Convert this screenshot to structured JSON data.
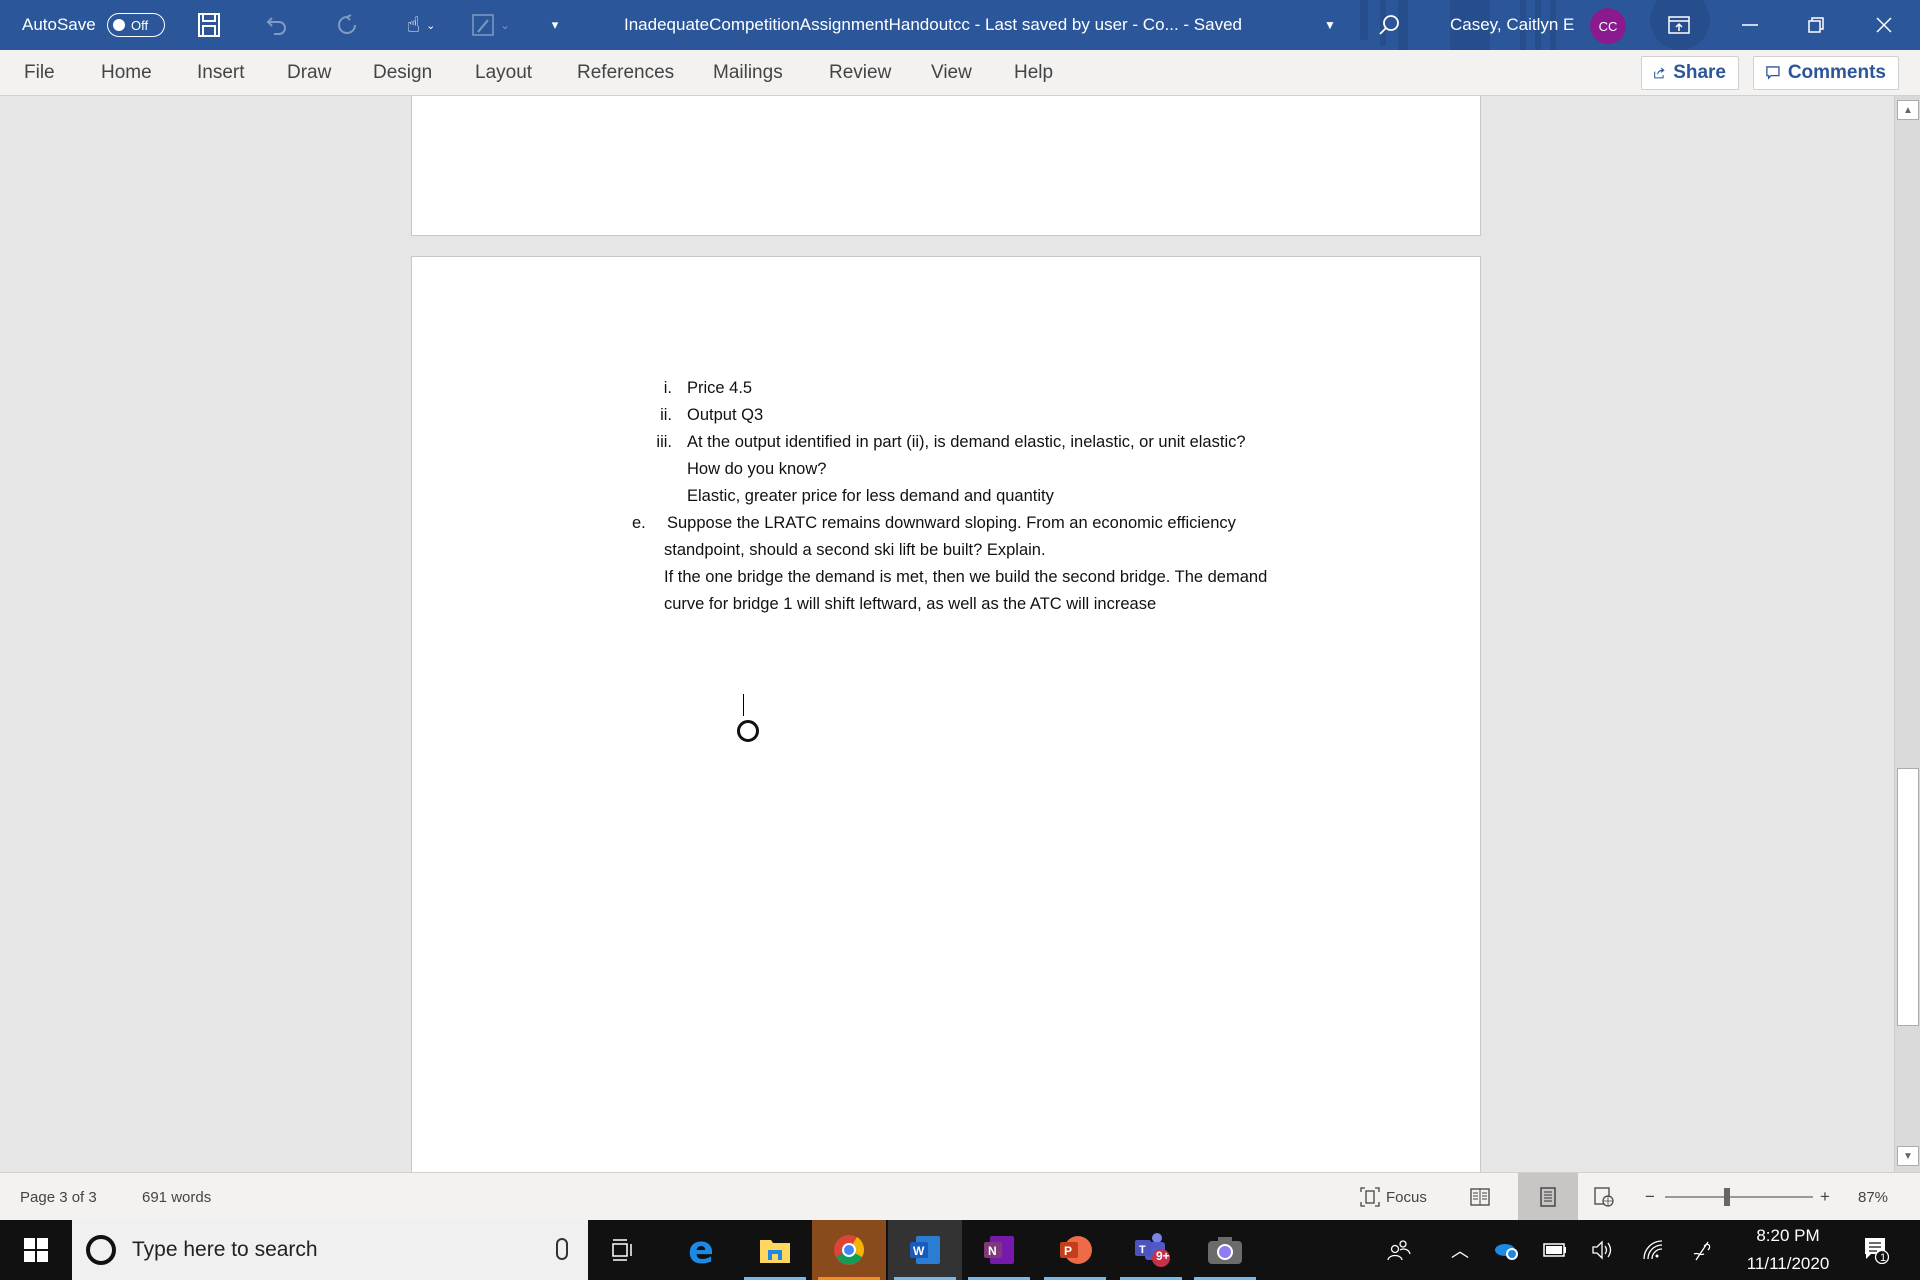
{
  "titlebar": {
    "autosave_label": "AutoSave",
    "autosave_state": "Off",
    "document_title": "InadequateCompetitionAssignmentHandoutcc  -  Last saved by user  -  Co...  -  Saved",
    "user_name": "Casey, Caitlyn E",
    "user_initials": "CC",
    "avatar_color": "#8b1a8f",
    "brand_color": "#2b579a"
  },
  "ribbon": {
    "tabs": [
      "File",
      "Home",
      "Insert",
      "Draw",
      "Design",
      "Layout",
      "References",
      "Mailings",
      "Review",
      "View",
      "Help"
    ],
    "share_label": "Share",
    "comments_label": "Comments"
  },
  "document": {
    "items": [
      {
        "marker": "i.",
        "text": "Price 4.5"
      },
      {
        "marker": "ii.",
        "text": "Output Q3"
      },
      {
        "marker": "iii.",
        "text": "At the output identified in part (ii), is demand elastic, inelastic, or unit elastic?"
      },
      {
        "marker": "",
        "text": "How do you know?"
      },
      {
        "marker": "",
        "text": "Elastic, greater price for less demand and quantity"
      },
      {
        "marker": "e.",
        "text": " Suppose the LRATC remains downward sloping.  From an economic efficiency"
      },
      {
        "marker": "",
        "text": "standpoint, should a second ski lift be built?  Explain."
      },
      {
        "marker": "",
        "text": "If the one bridge the demand is met, then we build the second bridge. The demand"
      },
      {
        "marker": "",
        "text": "curve for bridge 1 will shift leftward, as well as the ATC will increase"
      }
    ]
  },
  "statusbar": {
    "page_info": "Page 3 of 3",
    "word_count": "691 words",
    "focus_label": "Focus",
    "zoom_level": "87%",
    "zoom_minus": "−",
    "zoom_plus": "+"
  },
  "taskbar": {
    "search_placeholder": "Type here to search",
    "teams_badge": "9+",
    "time": "8:20 PM",
    "date": "11/11/2020",
    "notification_count": "1"
  }
}
